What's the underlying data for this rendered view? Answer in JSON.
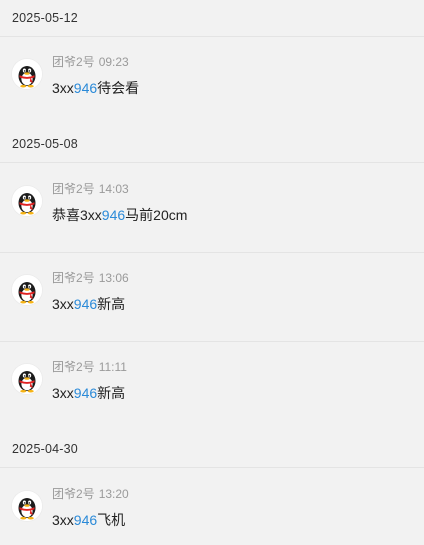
{
  "colors": {
    "background": "#f2f2f2",
    "meta_text": "#9a9a9a",
    "content_text": "#222222",
    "highlight": "#2b8ad8",
    "divider": "#e4e4e4"
  },
  "avatar_icon": "qq-penguin-icon",
  "groups": [
    {
      "date": "2025-05-12",
      "messages": [
        {
          "author": "团爷2号",
          "time": "09:23",
          "prefix": "3xx",
          "code": "946",
          "text": "待会看"
        }
      ]
    },
    {
      "date": "2025-05-08",
      "messages": [
        {
          "author": "团爷2号",
          "time": "14:03",
          "prefix": "恭喜3xx",
          "code": "946",
          "text": "马前20cm"
        },
        {
          "author": "团爷2号",
          "time": "13:06",
          "prefix": "3xx",
          "code": "946",
          "text": "新高"
        },
        {
          "author": "团爷2号",
          "time": "11:11",
          "prefix": "3xx",
          "code": "946",
          "text": "新高"
        }
      ]
    },
    {
      "date": "2025-04-30",
      "messages": [
        {
          "author": "团爷2号",
          "time": "13:20",
          "prefix": "3xx",
          "code": "946",
          "text": "飞机"
        }
      ]
    }
  ]
}
